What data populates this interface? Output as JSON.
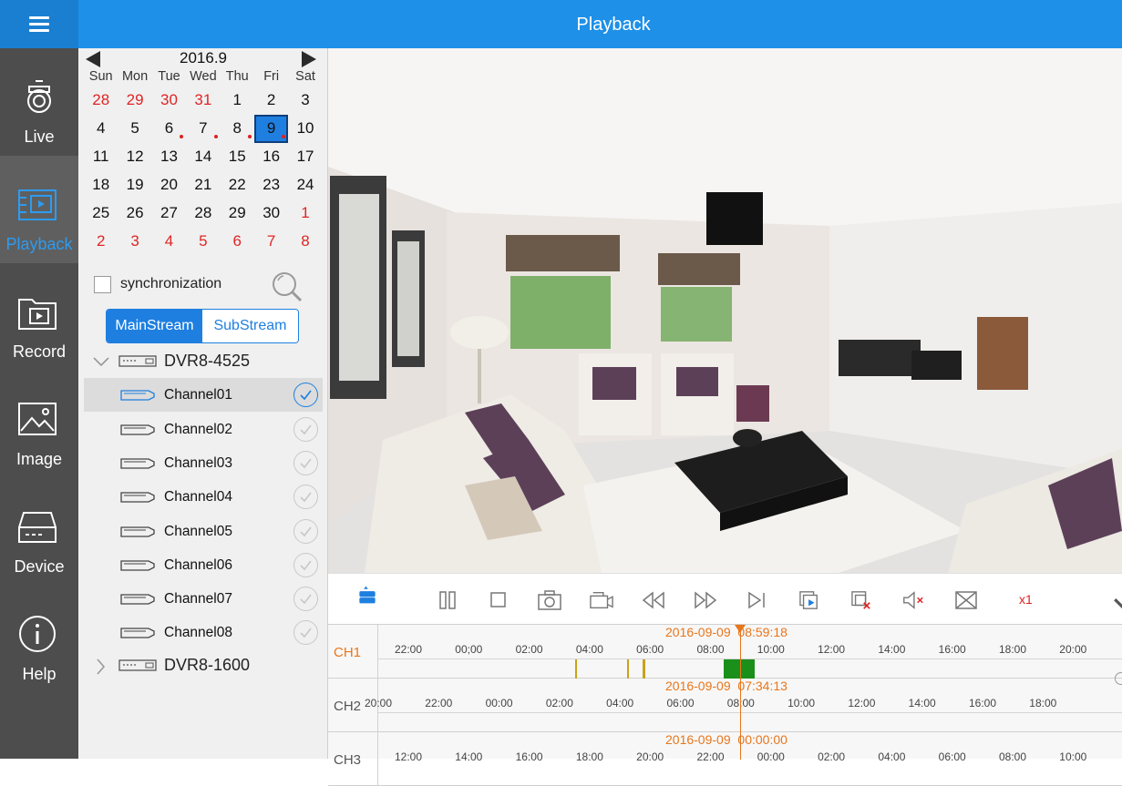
{
  "header": {
    "title": "Playback"
  },
  "nav": [
    {
      "label": "Live",
      "icon": "camera-icon"
    },
    {
      "label": "Playback",
      "icon": "playback-icon",
      "active": true
    },
    {
      "label": "Record",
      "icon": "record-folder-icon"
    },
    {
      "label": "Image",
      "icon": "image-icon"
    },
    {
      "label": "Device",
      "icon": "device-icon"
    },
    {
      "label": "Help",
      "icon": "help-icon"
    }
  ],
  "calendar": {
    "month": "2016.9",
    "weekdays": [
      "Sun",
      "Mon",
      "Tue",
      "Wed",
      "Thu",
      "Fri",
      "Sat"
    ],
    "weeks": [
      [
        "28",
        "29",
        "30",
        "31",
        "1",
        "2",
        "3"
      ],
      [
        "4",
        "5",
        "6",
        "7",
        "8",
        "9",
        "10"
      ],
      [
        "11",
        "12",
        "13",
        "14",
        "15",
        "16",
        "17"
      ],
      [
        "18",
        "19",
        "20",
        "21",
        "22",
        "23",
        "24"
      ],
      [
        "25",
        "26",
        "27",
        "28",
        "29",
        "30",
        "1"
      ],
      [
        "2",
        "3",
        "4",
        "5",
        "6",
        "7",
        "8"
      ]
    ],
    "selected": "9",
    "has_recording_days": [
      "6",
      "7",
      "8",
      "9"
    ]
  },
  "sync": {
    "label": "synchronization",
    "checked": false
  },
  "stream": {
    "main": "MainStream",
    "sub": "SubStream",
    "active": "main"
  },
  "devices": [
    {
      "name": "DVR8-4525",
      "expanded": true,
      "channels": [
        {
          "name": "Channel01",
          "selected": true
        },
        {
          "name": "Channel02",
          "selected": false
        },
        {
          "name": "Channel03",
          "selected": false
        },
        {
          "name": "Channel04",
          "selected": false
        },
        {
          "name": "Channel05",
          "selected": false
        },
        {
          "name": "Channel06",
          "selected": false
        },
        {
          "name": "Channel07",
          "selected": false
        },
        {
          "name": "Channel08",
          "selected": false
        }
      ]
    },
    {
      "name": "DVR8-1600",
      "expanded": false
    }
  ],
  "toolbar": {
    "speed": "x1"
  },
  "timeline": [
    {
      "label": "CH1",
      "active": true,
      "date": "2016-09-09",
      "time": "08:59:18",
      "ticks": [
        "22:00",
        "00;00",
        "02:00",
        "04:00",
        "06:00",
        "08:00",
        "10:00",
        "12:00",
        "14:00",
        "16:00",
        "18:00",
        "20:00"
      ]
    },
    {
      "label": "CH2",
      "active": false,
      "date": "2016-09-09",
      "time": "07:34:13",
      "ticks": [
        "20:00",
        "22:00",
        "00:00",
        "02:00",
        "04:00",
        "06:00",
        "08:00",
        "10:00",
        "12:00",
        "14:00",
        "16:00",
        "18:00"
      ]
    },
    {
      "label": "CH3",
      "active": false,
      "date": "2016-09-09",
      "time": "00:00:00",
      "ticks": [
        "12:00",
        "14:00",
        "16:00",
        "18:00",
        "20:00",
        "22:00",
        "00:00",
        "02:00",
        "04:00",
        "06:00",
        "08:00",
        "10:00"
      ]
    }
  ],
  "colors": {
    "accent": "#1e90e8",
    "sidebar": "#4d4d4d",
    "cursor": "#e8761b",
    "recording": "#1a8f1a",
    "event": "#c8a21a",
    "weekend_red": "#e02525"
  }
}
